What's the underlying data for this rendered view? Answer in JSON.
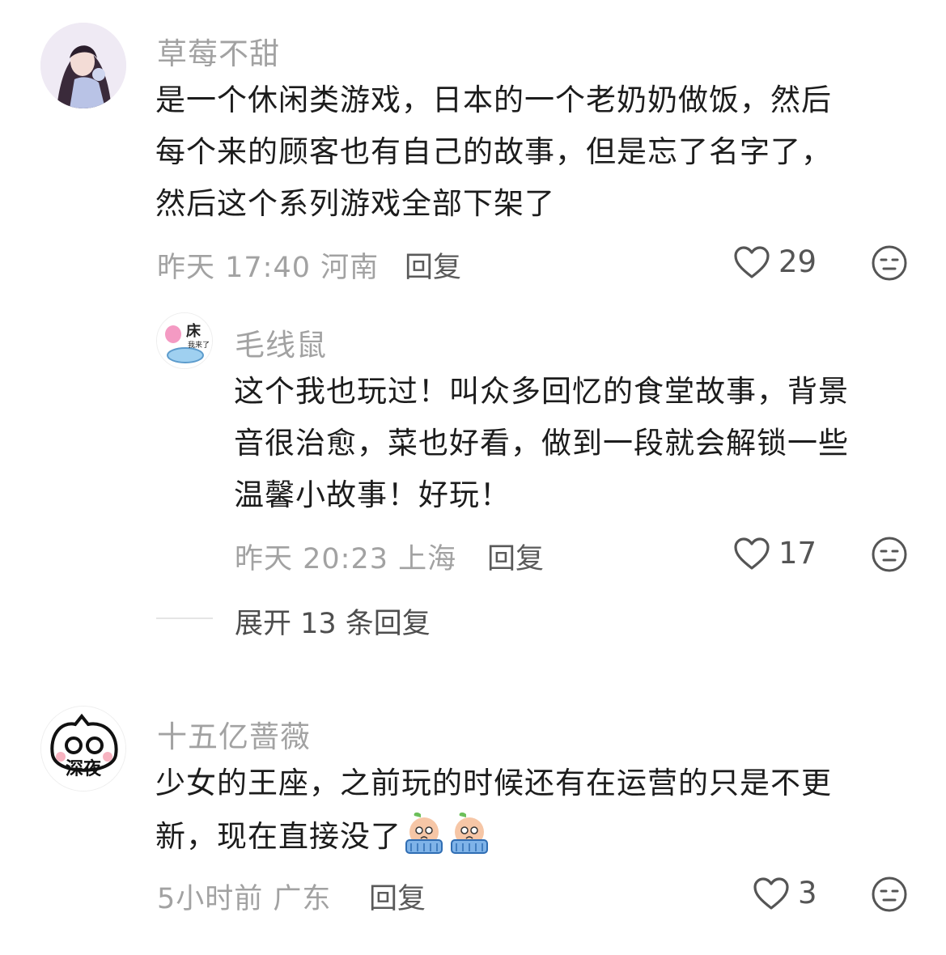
{
  "comments": [
    {
      "username": "草莓不甜",
      "lines": [
        "是一个休闲类游戏，日本的一个老奶奶做饭，然后",
        "每个来的顾客也有自己的故事，但是忘了名字了，",
        "然后这个系列游戏全部下架了"
      ],
      "time": "昨天 17:40",
      "location": "河南",
      "reply_label": "回复",
      "likes": "29"
    },
    {
      "username": "毛线鼠",
      "avatar_text_top": "床",
      "avatar_text_bottom": "我来了",
      "lines": [
        "这个我也玩过！叫众多回忆的食堂故事，背景",
        "音很治愈，菜也好看，做到一段就会解锁一些",
        "温馨小故事！好玩！"
      ],
      "time": "昨天 20:23",
      "location": "上海",
      "reply_label": "回复",
      "likes": "17"
    },
    {
      "username": "十五亿蔷薇",
      "avatar_text": "深夜",
      "lines": [
        "少女的王座，之前玩的时候还有在运营的只是不更",
        "新，现在直接没了"
      ],
      "time": "5小时前",
      "location": "广东",
      "reply_label": "回复",
      "likes": "3"
    }
  ],
  "expand_replies": "展开 13 条回复",
  "colors": {
    "meta": "#a2a2a2",
    "text": "#1c1c1c",
    "divider": "#e5e5e5"
  }
}
